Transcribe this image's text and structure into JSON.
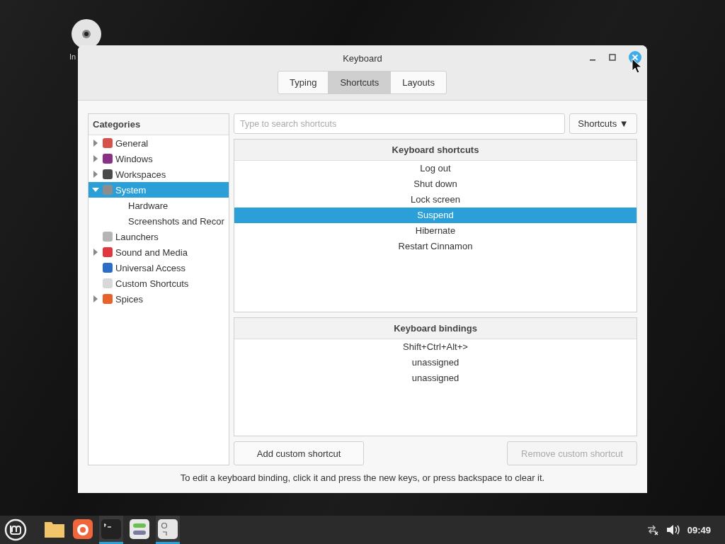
{
  "desktop_icon": {
    "label": "In"
  },
  "window": {
    "title": "Keyboard"
  },
  "tabs": [
    {
      "label": "Typing",
      "selected": false
    },
    {
      "label": "Shortcuts",
      "selected": true
    },
    {
      "label": "Layouts",
      "selected": false
    }
  ],
  "categories": {
    "heading": "Categories",
    "items": [
      {
        "label": "General",
        "color": "#d8504a",
        "expandable": true,
        "expanded": false,
        "selected": false
      },
      {
        "label": "Windows",
        "color": "#8a2f86",
        "expandable": true,
        "expanded": false,
        "selected": false
      },
      {
        "label": "Workspaces",
        "color": "#4a4a4a",
        "expandable": true,
        "expanded": false,
        "selected": false
      },
      {
        "label": "System",
        "color": "#8d8d8d",
        "expandable": true,
        "expanded": true,
        "selected": true,
        "children": [
          {
            "label": "Hardware",
            "selected": false
          },
          {
            "label": "Screenshots and Recor",
            "selected": false
          }
        ]
      },
      {
        "label": "Launchers",
        "color": "#b5b5b5",
        "expandable": false,
        "selected": false
      },
      {
        "label": "Sound and Media",
        "color": "#e0383e",
        "expandable": true,
        "expanded": false,
        "selected": false
      },
      {
        "label": "Universal Access",
        "color": "#2a6cc8",
        "expandable": false,
        "selected": false
      },
      {
        "label": "Custom Shortcuts",
        "color": "#d8d8d8",
        "expandable": false,
        "selected": false
      },
      {
        "label": "Spices",
        "color": "#e8602a",
        "expandable": true,
        "expanded": false,
        "selected": false
      }
    ]
  },
  "search": {
    "placeholder": "Type to search shortcuts"
  },
  "filter_button": {
    "label": "Shortcuts",
    "caret": "▼"
  },
  "shortcuts": {
    "heading": "Keyboard shortcuts",
    "rows": [
      {
        "label": "Log out",
        "selected": false
      },
      {
        "label": "Shut down",
        "selected": false
      },
      {
        "label": "Lock screen",
        "selected": false
      },
      {
        "label": "Suspend",
        "selected": true
      },
      {
        "label": "Hibernate",
        "selected": false
      },
      {
        "label": "Restart Cinnamon",
        "selected": false
      }
    ]
  },
  "bindings": {
    "heading": "Keyboard bindings",
    "rows": [
      "Shift+Ctrl+Alt+>",
      "unassigned",
      "unassigned"
    ]
  },
  "buttons": [
    {
      "label": "Add custom shortcut",
      "disabled": false
    },
    {
      "label": "Remove custom shortcut",
      "disabled": true
    }
  ],
  "hint": "To edit a keyboard binding, click it and press the new keys, or press backspace to clear it.",
  "taskbar": {
    "apps": [
      {
        "kind": "folder",
        "running": false
      },
      {
        "kind": "browser",
        "running": false
      },
      {
        "kind": "terminal",
        "running": true
      },
      {
        "kind": "toggles",
        "running": false
      },
      {
        "kind": "keys",
        "running": true
      }
    ],
    "clock": "09:49"
  }
}
